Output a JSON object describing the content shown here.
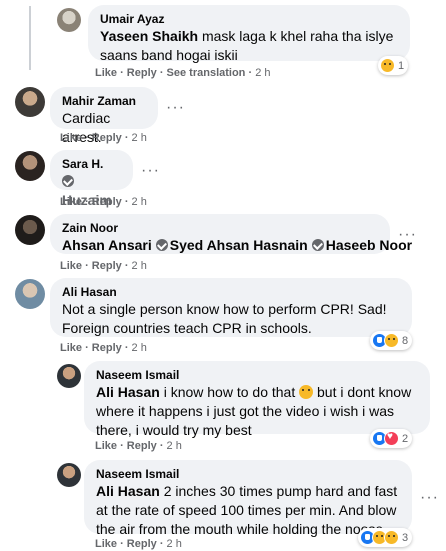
{
  "colors": {
    "bubble": "#f0f2f5",
    "meta": "#65676b",
    "like": "#1877f2",
    "love": "#f33e58",
    "sad": "#f7b928"
  },
  "comments": [
    {
      "author": "Umair Ayaz",
      "mention": "Yaseen Shaikh",
      "text": " mask laga k khel raha tha islye saans band hogai iskii",
      "actions": {
        "like": "Like",
        "reply": "Reply",
        "see_translation": "See translation",
        "time": "2 h"
      },
      "reactions": {
        "icons": [
          "sad"
        ],
        "count": "1"
      }
    },
    {
      "author": "Mahir Zaman",
      "text": "Cardiac arrest.",
      "actions": {
        "like": "Like",
        "reply": "Reply",
        "time": "2 h"
      }
    },
    {
      "author": "Sara H.",
      "tags": [
        "Huzaim"
      ],
      "actions": {
        "like": "Like",
        "reply": "Reply",
        "time": "2 h"
      }
    },
    {
      "author": "Zain Noor",
      "mention": "Ahsan Ansari",
      "tags": [
        "Syed Ahsan Hasnain",
        "Haseeb Noor"
      ],
      "actions": {
        "like": "Like",
        "reply": "Reply",
        "time": "2 h"
      }
    },
    {
      "author": "Ali Hasan",
      "text": "Not a single person know how to perform CPR! Sad! Foreign countries teach CPR in schools.",
      "actions": {
        "like": "Like",
        "reply": "Reply",
        "time": "2 h"
      },
      "reactions": {
        "icons": [
          "like",
          "sad"
        ],
        "count": "8"
      }
    },
    {
      "author": "Naseem Ismail",
      "mention": "Ali Hasan",
      "text_a": " i know how to do that ",
      "text_b": " but i dont know where it happens i just got the video i wish i was there, i would try my best",
      "actions": {
        "like": "Like",
        "reply": "Reply",
        "time": "2 h"
      },
      "reactions": {
        "icons": [
          "like",
          "love"
        ],
        "count": "2"
      }
    },
    {
      "author": "Naseem Ismail",
      "mention": "Ali Hasan",
      "text": " 2 inches 30 times pump hard and fast at the rate of speed 100 times per min. And blow the air from the mouth while holding the noose",
      "actions": {
        "like": "Like",
        "reply": "Reply",
        "time": "2 h"
      },
      "reactions": {
        "icons": [
          "like",
          "haha",
          "care"
        ],
        "count": "3"
      }
    }
  ]
}
